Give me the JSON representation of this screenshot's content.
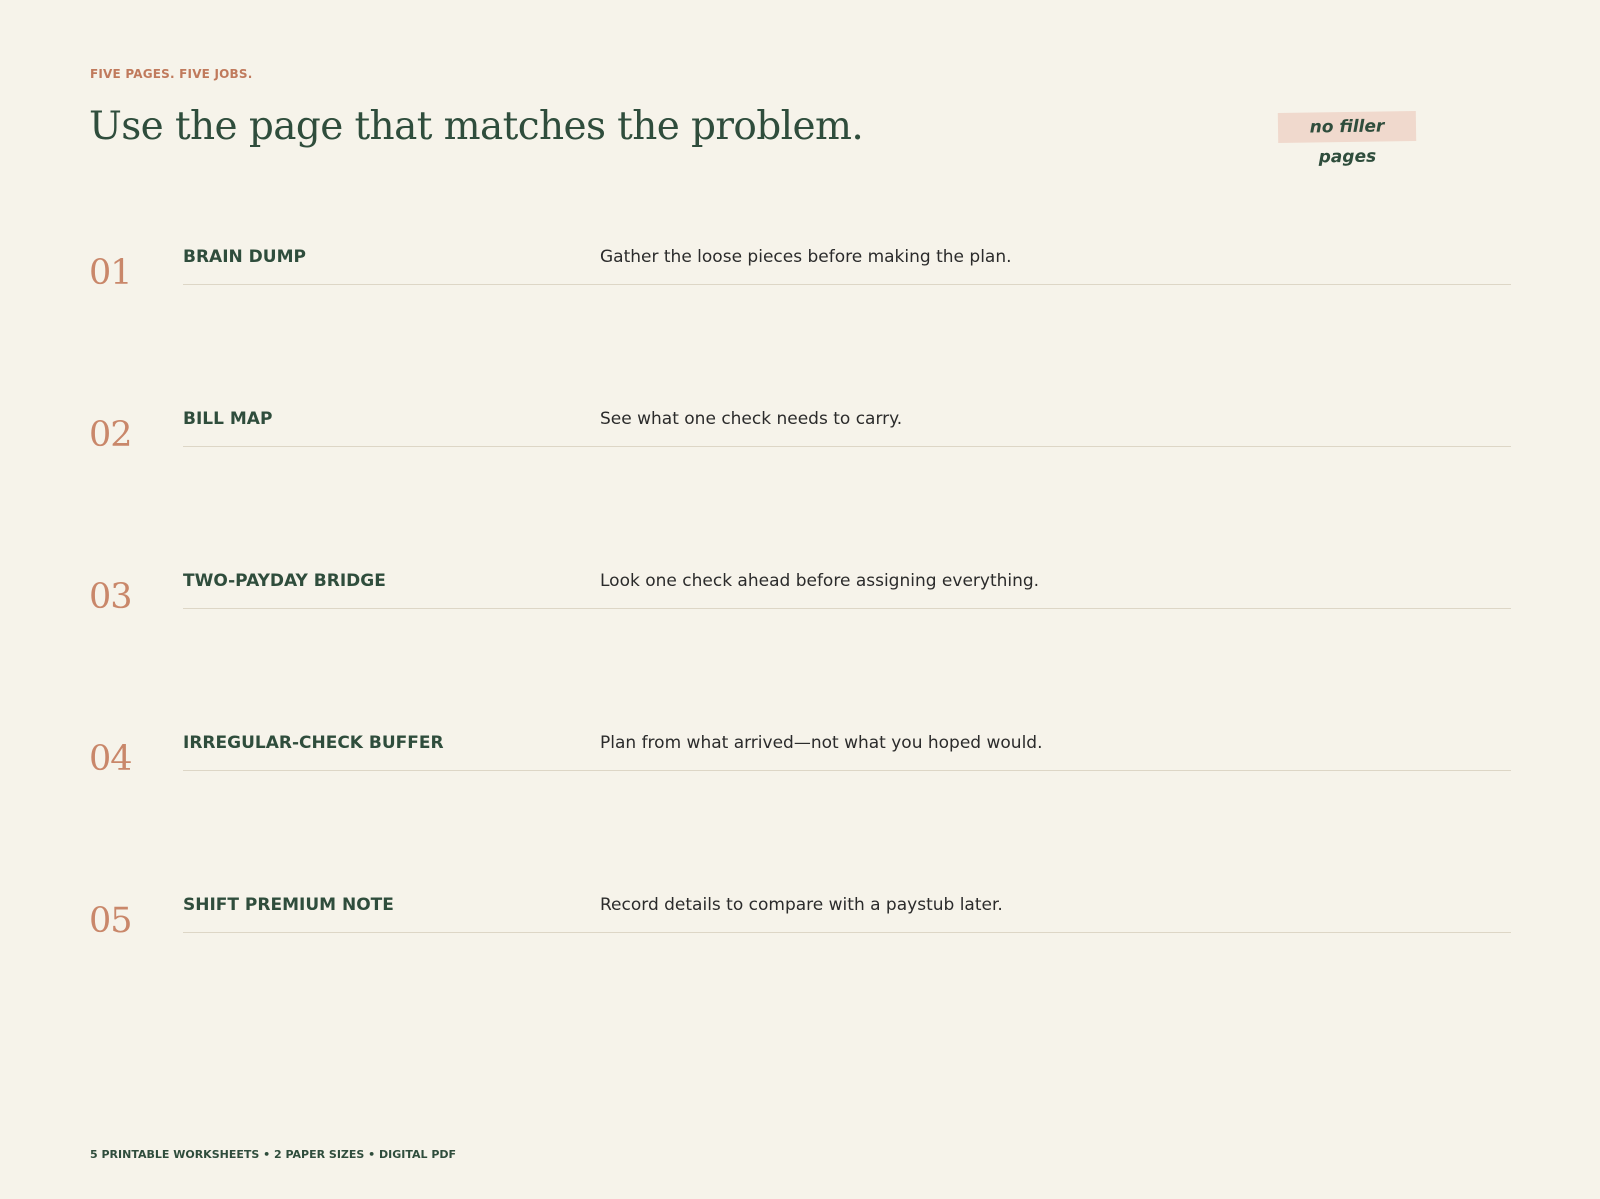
{
  "header": {
    "eyebrow": "FIVE PAGES. FIVE JOBS.",
    "title": "Use the page that matches the problem.",
    "tag": "no filler pages"
  },
  "pages": [
    {
      "number": "01",
      "name": "BRAIN DUMP",
      "description": "Gather the loose pieces before making the plan."
    },
    {
      "number": "02",
      "name": "BILL MAP",
      "description": "See what one check needs to carry."
    },
    {
      "number": "03",
      "name": "TWO-PAYDAY BRIDGE",
      "description": "Look one check ahead before assigning everything."
    },
    {
      "number": "04",
      "name": "IRREGULAR-CHECK BUFFER",
      "description": "Plan from what arrived—not what you hoped would."
    },
    {
      "number": "05",
      "name": "SHIFT PREMIUM NOTE",
      "description": "Record details to compare with a paystub later."
    }
  ],
  "footer": {
    "text": "5 PRINTABLE WORKSHEETS • 2 PAPER SIZES • DIGITAL PDF"
  },
  "colors": {
    "background": "#f6f3ea",
    "accent": "#c9876a",
    "primary": "#2f4d3c",
    "tag_background": "#f0d9cd"
  }
}
